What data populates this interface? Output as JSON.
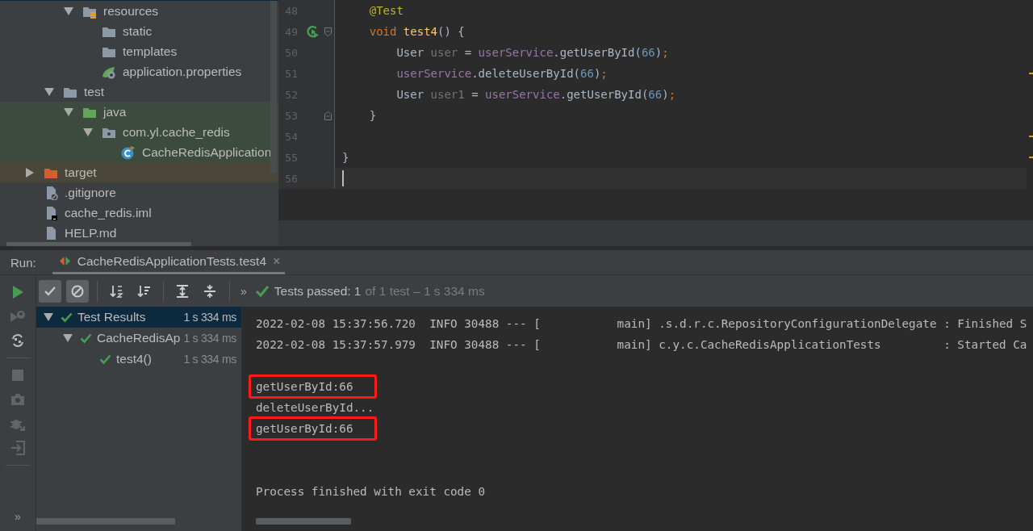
{
  "project_tree": {
    "items": [
      {
        "children": [
          {
            "children": [
              {
                "label": "resources",
                "kind": "resources-folder",
                "expanded": true,
                "children": [
                  {
                    "label": "static",
                    "kind": "folder"
                  },
                  {
                    "label": "templates",
                    "kind": "folder"
                  },
                  {
                    "label": "application.properties",
                    "kind": "properties"
                  }
                ]
              }
            ]
          },
          {
            "label": "test",
            "kind": "folder",
            "expanded": true,
            "children": [
              {
                "label": "java",
                "kind": "test-folder",
                "in_test_root": true,
                "expanded": true,
                "children": [
                  {
                    "label": "com.yl.cache_redis",
                    "kind": "package",
                    "in_test_root": true,
                    "expanded": true,
                    "children": [
                      {
                        "label": "CacheRedisApplication",
                        "kind": "class",
                        "in_test_root": true
                      }
                    ]
                  }
                ]
              }
            ]
          }
        ]
      },
      {
        "label": "target",
        "kind": "excluded-folder",
        "excluded": true,
        "expanded": false
      },
      {
        "label": ".gitignore",
        "kind": "ignore-file"
      },
      {
        "label": "cache_redis.iml",
        "kind": "module-file"
      },
      {
        "label": "HELP.md",
        "kind": "file"
      }
    ]
  },
  "editor": {
    "lines": [
      {
        "number": "48",
        "tokens": [
          {
            "text": "    @Test",
            "kind": "annotation"
          }
        ]
      },
      {
        "number": "49",
        "run_icon": true,
        "fold_start": true,
        "tokens": [
          {
            "text": "    void",
            "kind": "keyword"
          },
          {
            "text": " test4",
            "kind": "method"
          },
          {
            "text": "() {",
            "kind": "plain"
          }
        ]
      },
      {
        "number": "50",
        "tokens": [
          {
            "text": "        User",
            "kind": "plain"
          },
          {
            "text": " user",
            "kind": "unused"
          },
          {
            "text": " = ",
            "kind": "plain"
          },
          {
            "text": "userService",
            "kind": "field"
          },
          {
            "text": ".getUserById(",
            "kind": "plain"
          },
          {
            "text": "66",
            "kind": "number"
          },
          {
            "text": ")",
            "kind": "plain"
          },
          {
            "text": ";",
            "kind": "keyword"
          }
        ]
      },
      {
        "number": "51",
        "stripe_mark": true,
        "tokens": [
          {
            "text": "        userService",
            "kind": "field"
          },
          {
            "text": ".deleteUserById(",
            "kind": "plain"
          },
          {
            "text": "66",
            "kind": "number"
          },
          {
            "text": ")",
            "kind": "plain"
          },
          {
            "text": ";",
            "kind": "keyword"
          }
        ]
      },
      {
        "number": "52",
        "tokens": [
          {
            "text": "        User",
            "kind": "plain"
          },
          {
            "text": " user1",
            "kind": "unused"
          },
          {
            "text": " = ",
            "kind": "plain"
          },
          {
            "text": "userService",
            "kind": "field"
          },
          {
            "text": ".getUserById(",
            "kind": "plain"
          },
          {
            "text": "66",
            "kind": "number"
          },
          {
            "text": ")",
            "kind": "plain"
          },
          {
            "text": ";",
            "kind": "keyword"
          }
        ]
      },
      {
        "number": "53",
        "fold_end": true,
        "tokens": [
          {
            "text": "    }",
            "kind": "plain"
          }
        ]
      },
      {
        "number": "54",
        "stripe_mark": true
      },
      {
        "number": "55",
        "stripe_mark": true,
        "tokens": [
          {
            "text": "}",
            "kind": "plain"
          }
        ]
      },
      {
        "number": "56",
        "current": true
      }
    ]
  },
  "run_panel": {
    "label": "Run:",
    "tab": {
      "title": "CacheRedisApplicationTests.test4",
      "close": "×",
      "selected": true
    },
    "side_toolbar": [
      {
        "kind": "run",
        "disabled": false
      },
      {
        "kind": "rerun-failed",
        "disabled": true
      },
      {
        "kind": "auto-test",
        "disabled": false
      },
      {
        "kind": "separator"
      },
      {
        "kind": "stop",
        "disabled": true
      },
      {
        "kind": "camera",
        "disabled": true
      },
      {
        "kind": "export",
        "disabled": true
      },
      {
        "kind": "import",
        "disabled": true
      },
      {
        "kind": "separator"
      }
    ],
    "side_more": "»",
    "toolbar": [
      {
        "kind": "show-passed",
        "selected": true
      },
      {
        "kind": "show-ignored",
        "selected": true
      },
      {
        "kind": "separator"
      },
      {
        "kind": "sort-alpha",
        "selected": false
      },
      {
        "kind": "sort-duration",
        "selected": false
      },
      {
        "kind": "separator"
      },
      {
        "kind": "expand-all",
        "selected": false
      },
      {
        "kind": "collapse-all",
        "selected": false
      },
      {
        "kind": "separator"
      }
    ],
    "toolbar_more": "»",
    "status": {
      "passed": "Tests passed: 1",
      "detail": "of 1 test – 1 s 334 ms"
    },
    "test_tree": [
      {
        "label": "Test Results",
        "time": "1 s 334 ms",
        "selected": true,
        "expanded": true,
        "children": [
          {
            "label": "CacheRedisAp",
            "time": "1 s 334 ms",
            "selected": false,
            "expanded": true,
            "children": [
              {
                "label": "test4()",
                "time": "1 s 334 ms",
                "selected": false
              }
            ]
          }
        ]
      }
    ],
    "console": [
      {
        "kind": "log",
        "text": "2022-02-08 15:37:56.720  INFO 30488 --- [           main] .s.d.r.c.RepositoryConfigurationDelegate : Finished S",
        "highlighted": false
      },
      {
        "kind": "log",
        "text": "2022-02-08 15:37:57.979  INFO 30488 --- [           main] c.y.c.CacheRedisApplicationTests         : Started Ca",
        "highlighted": false
      },
      {
        "kind": "output",
        "text": "getUserById:66",
        "highlighted": true
      },
      {
        "kind": "output",
        "text": "deleteUserById...",
        "highlighted": false
      },
      {
        "kind": "output",
        "text": "getUserById:66",
        "highlighted": true
      },
      {
        "kind": "exit",
        "text": "Process finished with exit code 0",
        "highlighted": false
      }
    ]
  }
}
